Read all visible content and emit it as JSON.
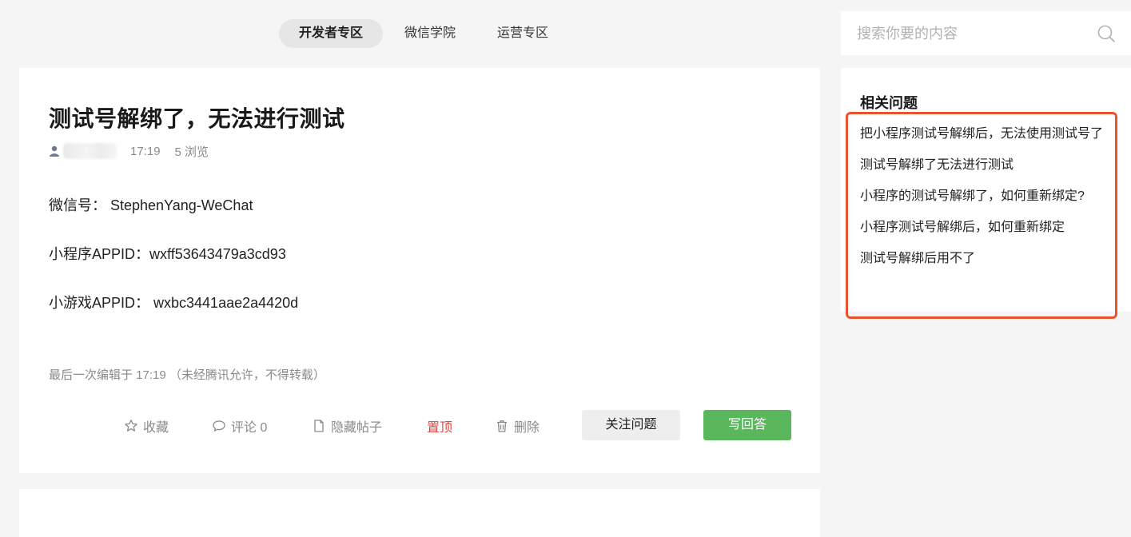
{
  "nav": {
    "tabs": [
      {
        "label": "开发者专区",
        "active": true
      },
      {
        "label": "微信学院",
        "active": false
      },
      {
        "label": "运营专区",
        "active": false
      }
    ]
  },
  "post": {
    "title": "测试号解绑了，无法进行测试",
    "time": "17:19",
    "views": "5 浏览",
    "lines": [
      "微信号：  StephenYang-WeChat",
      "小程序APPID：wxff53643479a3cd93",
      "小游戏APPID：  wxbc3441aae2a4420d"
    ],
    "edit_note": "最后一次编辑于  17:19    （未经腾讯允许，不得转载）",
    "actions": {
      "favorite": "收藏",
      "comment": "评论 0",
      "hide": "隐藏帖子",
      "pin": "置顶",
      "delete": "删除",
      "follow": "关注问题",
      "answer": "写回答"
    }
  },
  "search": {
    "placeholder": "搜索你要的内容"
  },
  "related": {
    "title": "相关问题",
    "items": [
      "把小程序测试号解绑后，无法使用测试号了",
      "测试号解绑了无法进行测试",
      "小程序的测试号解绑了，如何重新绑定?",
      "小程序测试号解绑后，如何重新绑定",
      "测试号解绑后用不了"
    ]
  },
  "colors": {
    "accent_green": "#5ab75c",
    "pin_red": "#e64340",
    "highlight_border": "#e9542f"
  }
}
